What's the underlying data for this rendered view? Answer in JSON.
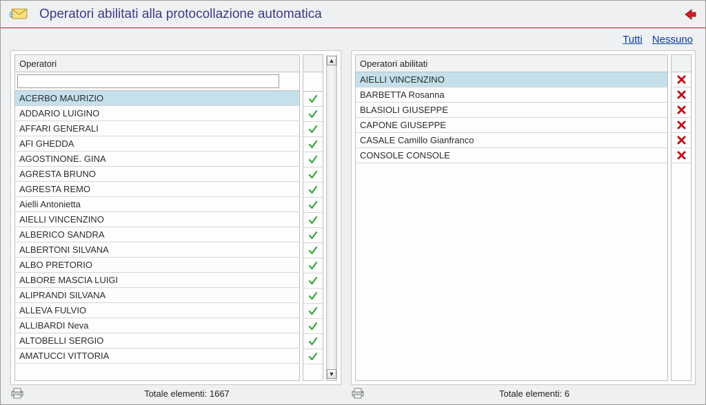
{
  "header": {
    "title": "Operatori abilitati alla protocollazione automatica"
  },
  "toolbar": {
    "all": "Tutti",
    "none": "Nessuno"
  },
  "left": {
    "header": "Operatori",
    "search_value": "",
    "items": [
      "ACERBO MAURIZIO",
      "ADDARIO LUIGINO",
      "AFFARI GENERALI",
      "AFI GHEDDA",
      "AGOSTINONE. GINA",
      "AGRESTA BRUNO",
      "AGRESTA REMO",
      "Aielli Antonietta",
      "AIELLI VINCENZINO",
      "ALBERICO SANDRA",
      "ALBERTONI SILVANA",
      "ALBO PRETORIO",
      "ALBORE MASCIA LUIGI",
      "ALIPRANDI SILVANA",
      "ALLEVA FULVIO",
      "ALLIBARDI Neva",
      "ALTOBELLI SERGIO",
      "AMATUCCI VITTORIA"
    ],
    "selected_index": 0,
    "total_label": "Totale elementi: 1667"
  },
  "right": {
    "header": "Operatori abilitati",
    "items": [
      "AIELLI VINCENZINO",
      "BARBETTA Rosanna",
      "BLASIOLI GIUSEPPE",
      "CAPONE GIUSEPPE",
      "CASALE Camillo Gianfranco",
      "CONSOLE CONSOLE"
    ],
    "selected_index": 0,
    "total_label": "Totale elementi: 6"
  }
}
